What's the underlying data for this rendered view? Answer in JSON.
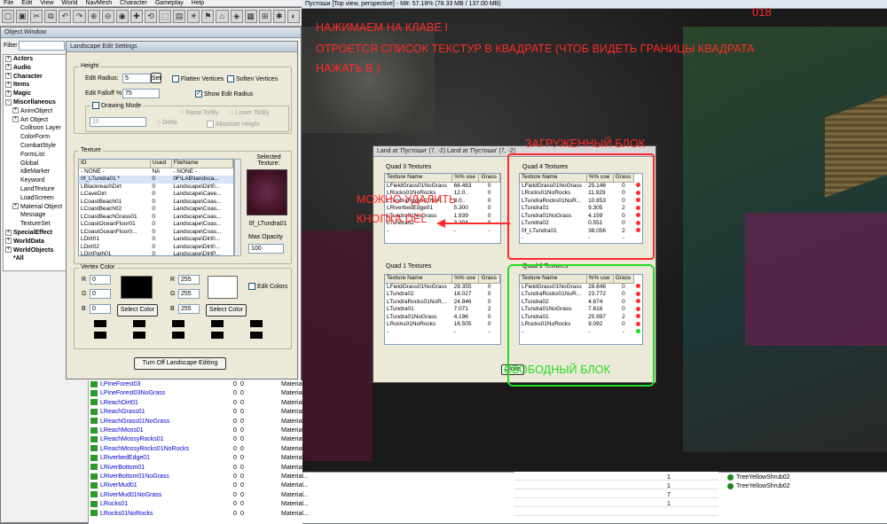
{
  "menu": [
    "File",
    "Edit",
    "View",
    "World",
    "NavMesh",
    "Character",
    "Gameplay",
    "Help"
  ],
  "object_window": {
    "title": "Object Window",
    "filter_label": "Filter",
    "tree": [
      {
        "label": "Actors",
        "level": 0,
        "exp": "+"
      },
      {
        "label": "Audio",
        "level": 0,
        "exp": "+"
      },
      {
        "label": "Character",
        "level": 0,
        "exp": "+"
      },
      {
        "label": "Items",
        "level": 0,
        "exp": "+"
      },
      {
        "label": "Magic",
        "level": 0,
        "exp": "+"
      },
      {
        "label": "Miscellaneous",
        "level": 0,
        "exp": "-"
      },
      {
        "label": "AnimObject",
        "level": 1,
        "exp": "+"
      },
      {
        "label": "Art Object",
        "level": 1,
        "exp": "+"
      },
      {
        "label": "Collision Layer",
        "level": 1,
        "exp": ""
      },
      {
        "label": "ColorForm",
        "level": 1,
        "exp": ""
      },
      {
        "label": "CombatStyle",
        "level": 1,
        "exp": ""
      },
      {
        "label": "FormList",
        "level": 1,
        "exp": ""
      },
      {
        "label": "Global",
        "level": 1,
        "exp": ""
      },
      {
        "label": "IdleMarker",
        "level": 1,
        "exp": ""
      },
      {
        "label": "Keyword",
        "level": 1,
        "exp": ""
      },
      {
        "label": "LandTexture",
        "level": 1,
        "exp": ""
      },
      {
        "label": "LoadScreen",
        "level": 1,
        "exp": ""
      },
      {
        "label": "Material Object",
        "level": 1,
        "exp": "+"
      },
      {
        "label": "Message",
        "level": 1,
        "exp": ""
      },
      {
        "label": "TextureSet",
        "level": 1,
        "exp": ""
      },
      {
        "label": "SpecialEffect",
        "level": 0,
        "exp": "+"
      },
      {
        "label": "WorldData",
        "level": 0,
        "exp": "+"
      },
      {
        "label": "WorldObjects",
        "level": 0,
        "exp": "+"
      },
      {
        "label": "*All",
        "level": 0,
        "exp": ""
      }
    ],
    "rows": [
      {
        "name": "LPineForest03",
        "c1": "0",
        "c2": "0",
        "c3": "Material..."
      },
      {
        "name": "LPineForest03NoGrass",
        "c1": "0",
        "c2": "0",
        "c3": "Material..."
      },
      {
        "name": "LReachDirt01",
        "c1": "0",
        "c2": "0",
        "c3": "Material..."
      },
      {
        "name": "LReachGrass01",
        "c1": "0",
        "c2": "0",
        "c3": "Material..."
      },
      {
        "name": "LReachGrass01NoGrass",
        "c1": "0",
        "c2": "0",
        "c3": "Material..."
      },
      {
        "name": "LReachMoss01",
        "c1": "0",
        "c2": "0",
        "c3": "Material..."
      },
      {
        "name": "LReachMossyRocks01",
        "c1": "0",
        "c2": "0",
        "c3": "Material..."
      },
      {
        "name": "LReachMossyRocks01NoRocks",
        "c1": "0",
        "c2": "0",
        "c3": "Material..."
      },
      {
        "name": "LRiverbedEdge01",
        "c1": "0",
        "c2": "0",
        "c3": "Material..."
      },
      {
        "name": "LRiverBottom01",
        "c1": "0",
        "c2": "0",
        "c3": "Material..."
      },
      {
        "name": "LRiverBottom01NoGrass",
        "c1": "0",
        "c2": "0",
        "c3": "Material..."
      },
      {
        "name": "LRiverMud01",
        "c1": "0",
        "c2": "0",
        "c3": "Material..."
      },
      {
        "name": "LRiverMud01NoGrass",
        "c1": "0",
        "c2": "0",
        "c3": "Material..."
      },
      {
        "name": "LRocks01",
        "c1": "0",
        "c2": "0",
        "c3": "Material..."
      },
      {
        "name": "LRocks01NoRocks",
        "c1": "0",
        "c2": "0",
        "c3": "Material..."
      }
    ]
  },
  "landscape": {
    "title": "Landscape Edit Settings",
    "height_group": "Height",
    "edit_radius_label": "Edit Radius:",
    "edit_radius_value": "5",
    "set_label": "Set",
    "flatten_label": "Flatten Vertices",
    "soften_label": "Soften Vertices",
    "falloff_label": "Edit Falloff %:",
    "falloff_value": "75",
    "show_radius_label": "Show Edit Radius",
    "drawing_mode_label": "Drawing Mode",
    "drawing_value": "10",
    "raise_label": "Raise To/By",
    "lower_label": "Lower To/By",
    "delta_label": "Delta",
    "absolute_label": "Absolute Height",
    "texture_group": "Texture",
    "tex_headers": [
      "ID",
      "Used",
      "FileName"
    ],
    "textures": [
      [
        "- NONE -",
        "NA",
        "- NONE -"
      ],
      [
        "0f_LTundra01 *",
        "0",
        "0F\\LAB\\landsca..."
      ],
      [
        "LBlackreachDirt",
        "0",
        "Landscape\\Dirt0..."
      ],
      [
        "LCaveDirt",
        "0",
        "Landscape\\Cave..."
      ],
      [
        "LCoastBeach01",
        "0",
        "Landscape\\Coas..."
      ],
      [
        "LCoastBeach02",
        "0",
        "Landscape\\Coas..."
      ],
      [
        "LCoastBeachGrass01",
        "0",
        "Landscape\\Coas..."
      ],
      [
        "LCoastOceanFloor01",
        "0",
        "Landscape\\Coas..."
      ],
      [
        "LCoastOceanFloor0...",
        "0",
        "Landscape\\Coas..."
      ],
      [
        "LDirt01",
        "0",
        "Landscape\\Dirt0..."
      ],
      [
        "LDirt02",
        "0",
        "Landscape\\Dirt0..."
      ],
      [
        "LDirtPath01",
        "0",
        "Landscape\\DirtP..."
      ]
    ],
    "selected_texture_label": "Selected Texture:",
    "selected_texture_name": "0f_LTundra01",
    "max_opacity_label": "Max Opacity",
    "max_opacity_value": "100",
    "vertex_group": "Vertex Color",
    "r_label": "R",
    "g_label": "G",
    "b_label": "B",
    "left_r": "0",
    "left_g": "0",
    "left_b": "0",
    "right_r": "255",
    "right_g": "255",
    "right_b": "255",
    "select_color_label": "Select Color",
    "edit_colors_label": "Edit Colors",
    "turn_off_label": "Turn Off Landscape Editing"
  },
  "viewport": {
    "title": "Пустоши [Top view, perspective] - M#: 57.18% (78.33 MB / 137.00 MB)",
    "corner_number": "018"
  },
  "land_dialog": {
    "title": "Land at 'Пустоши' (7, -2) Land at 'Пустоши' (7, -2)",
    "headers": [
      "Texture Name",
      "%% use",
      "Grass"
    ],
    "q3": {
      "title": "Quad 3 Textures",
      "rows": [
        [
          "LFieldGrass01NoGrass",
          "66.463",
          "0"
        ],
        [
          "LRocks01NoRocks",
          "12.0..",
          "0"
        ],
        [
          "LTundraRocks01NoR...",
          "8.0..",
          "0"
        ],
        [
          "LRiverbedEdge01",
          "5.300",
          "0"
        ],
        [
          "LTundra01NoGrass",
          "1.939",
          "0"
        ],
        [
          "LTundra02",
          "3.204",
          "0"
        ],
        [
          "-",
          "-",
          "-"
        ]
      ]
    },
    "q4": {
      "title": "Quad 4 Textures",
      "rows": [
        [
          "LFieldGrass01NoGrass",
          "25.146",
          "0"
        ],
        [
          "LRocks01NoRocks",
          "11.929",
          "0"
        ],
        [
          "LTundraRocks01NoR...",
          "10.853",
          "0"
        ],
        [
          "LTundra01",
          "9.305",
          "2"
        ],
        [
          "LTundra01NoGrass",
          "4.159",
          "0"
        ],
        [
          "LTundra02",
          "0.551",
          "0"
        ],
        [
          "0f_LTundra01",
          "38.056",
          "2"
        ],
        [
          "-",
          "-",
          "-"
        ]
      ]
    },
    "q1": {
      "title": "Quad 1 Textures",
      "rows": [
        [
          "LFieldGrass01NoGrass",
          "29.355",
          "0"
        ],
        [
          "LTundra02",
          "18.027",
          "0"
        ],
        [
          "LTundraRocks01NoR...",
          "24.846",
          "0"
        ],
        [
          "LTundra01",
          "7.071",
          "2"
        ],
        [
          "LTundra01NoGrass",
          "4.196",
          "0"
        ],
        [
          "LRocks01NoRocks",
          "16.505",
          "0"
        ],
        [
          "-",
          "-",
          "-"
        ]
      ]
    },
    "q2": {
      "title": "Quad 2 Textures",
      "rows": [
        [
          "LFieldGrass01NoGrass",
          "28.848",
          "0"
        ],
        [
          "LTundraRocks01NoR...",
          "23.772",
          "0"
        ],
        [
          "LTundra02",
          "4.674",
          "0"
        ],
        [
          "LTundra01NoGrass",
          "7.616",
          "0"
        ],
        [
          "LTundra01",
          "25.997",
          "2"
        ],
        [
          "LRocks01NoRocks",
          "9.092",
          "0"
        ],
        [
          "-",
          "-",
          "-"
        ]
      ]
    },
    "close_label": "Close"
  },
  "annotations": {
    "line1": "НАЖИМАЕМ НА КЛАВЕ    I",
    "line2": "ОТРОЕТСЯ СПИСОК ТЕКСТУР В КВАДРАТЕ  (ЧТОБ ВИДЕТЬ ГРАНИЦЫ КВАДРАТА",
    "line3": "НАЖАТЬ В  )",
    "loaded": "ЗАГРУЖЕННЫЙ БЛОК",
    "del1": "МОЖНО УДАЛИТЬ",
    "del2": "КНОПКА DEL",
    "free": "СВОБОДНЫЙ БЛОК"
  },
  "bottom_right": {
    "items": [
      "TreeYellowShrub02",
      "TreeYellowShrub02"
    ],
    "nums": [
      "1",
      "1",
      "7",
      "1"
    ]
  },
  "colors": {
    "red": "#ff2a2a",
    "green": "#22dd22",
    "accent": "#1c5180"
  }
}
